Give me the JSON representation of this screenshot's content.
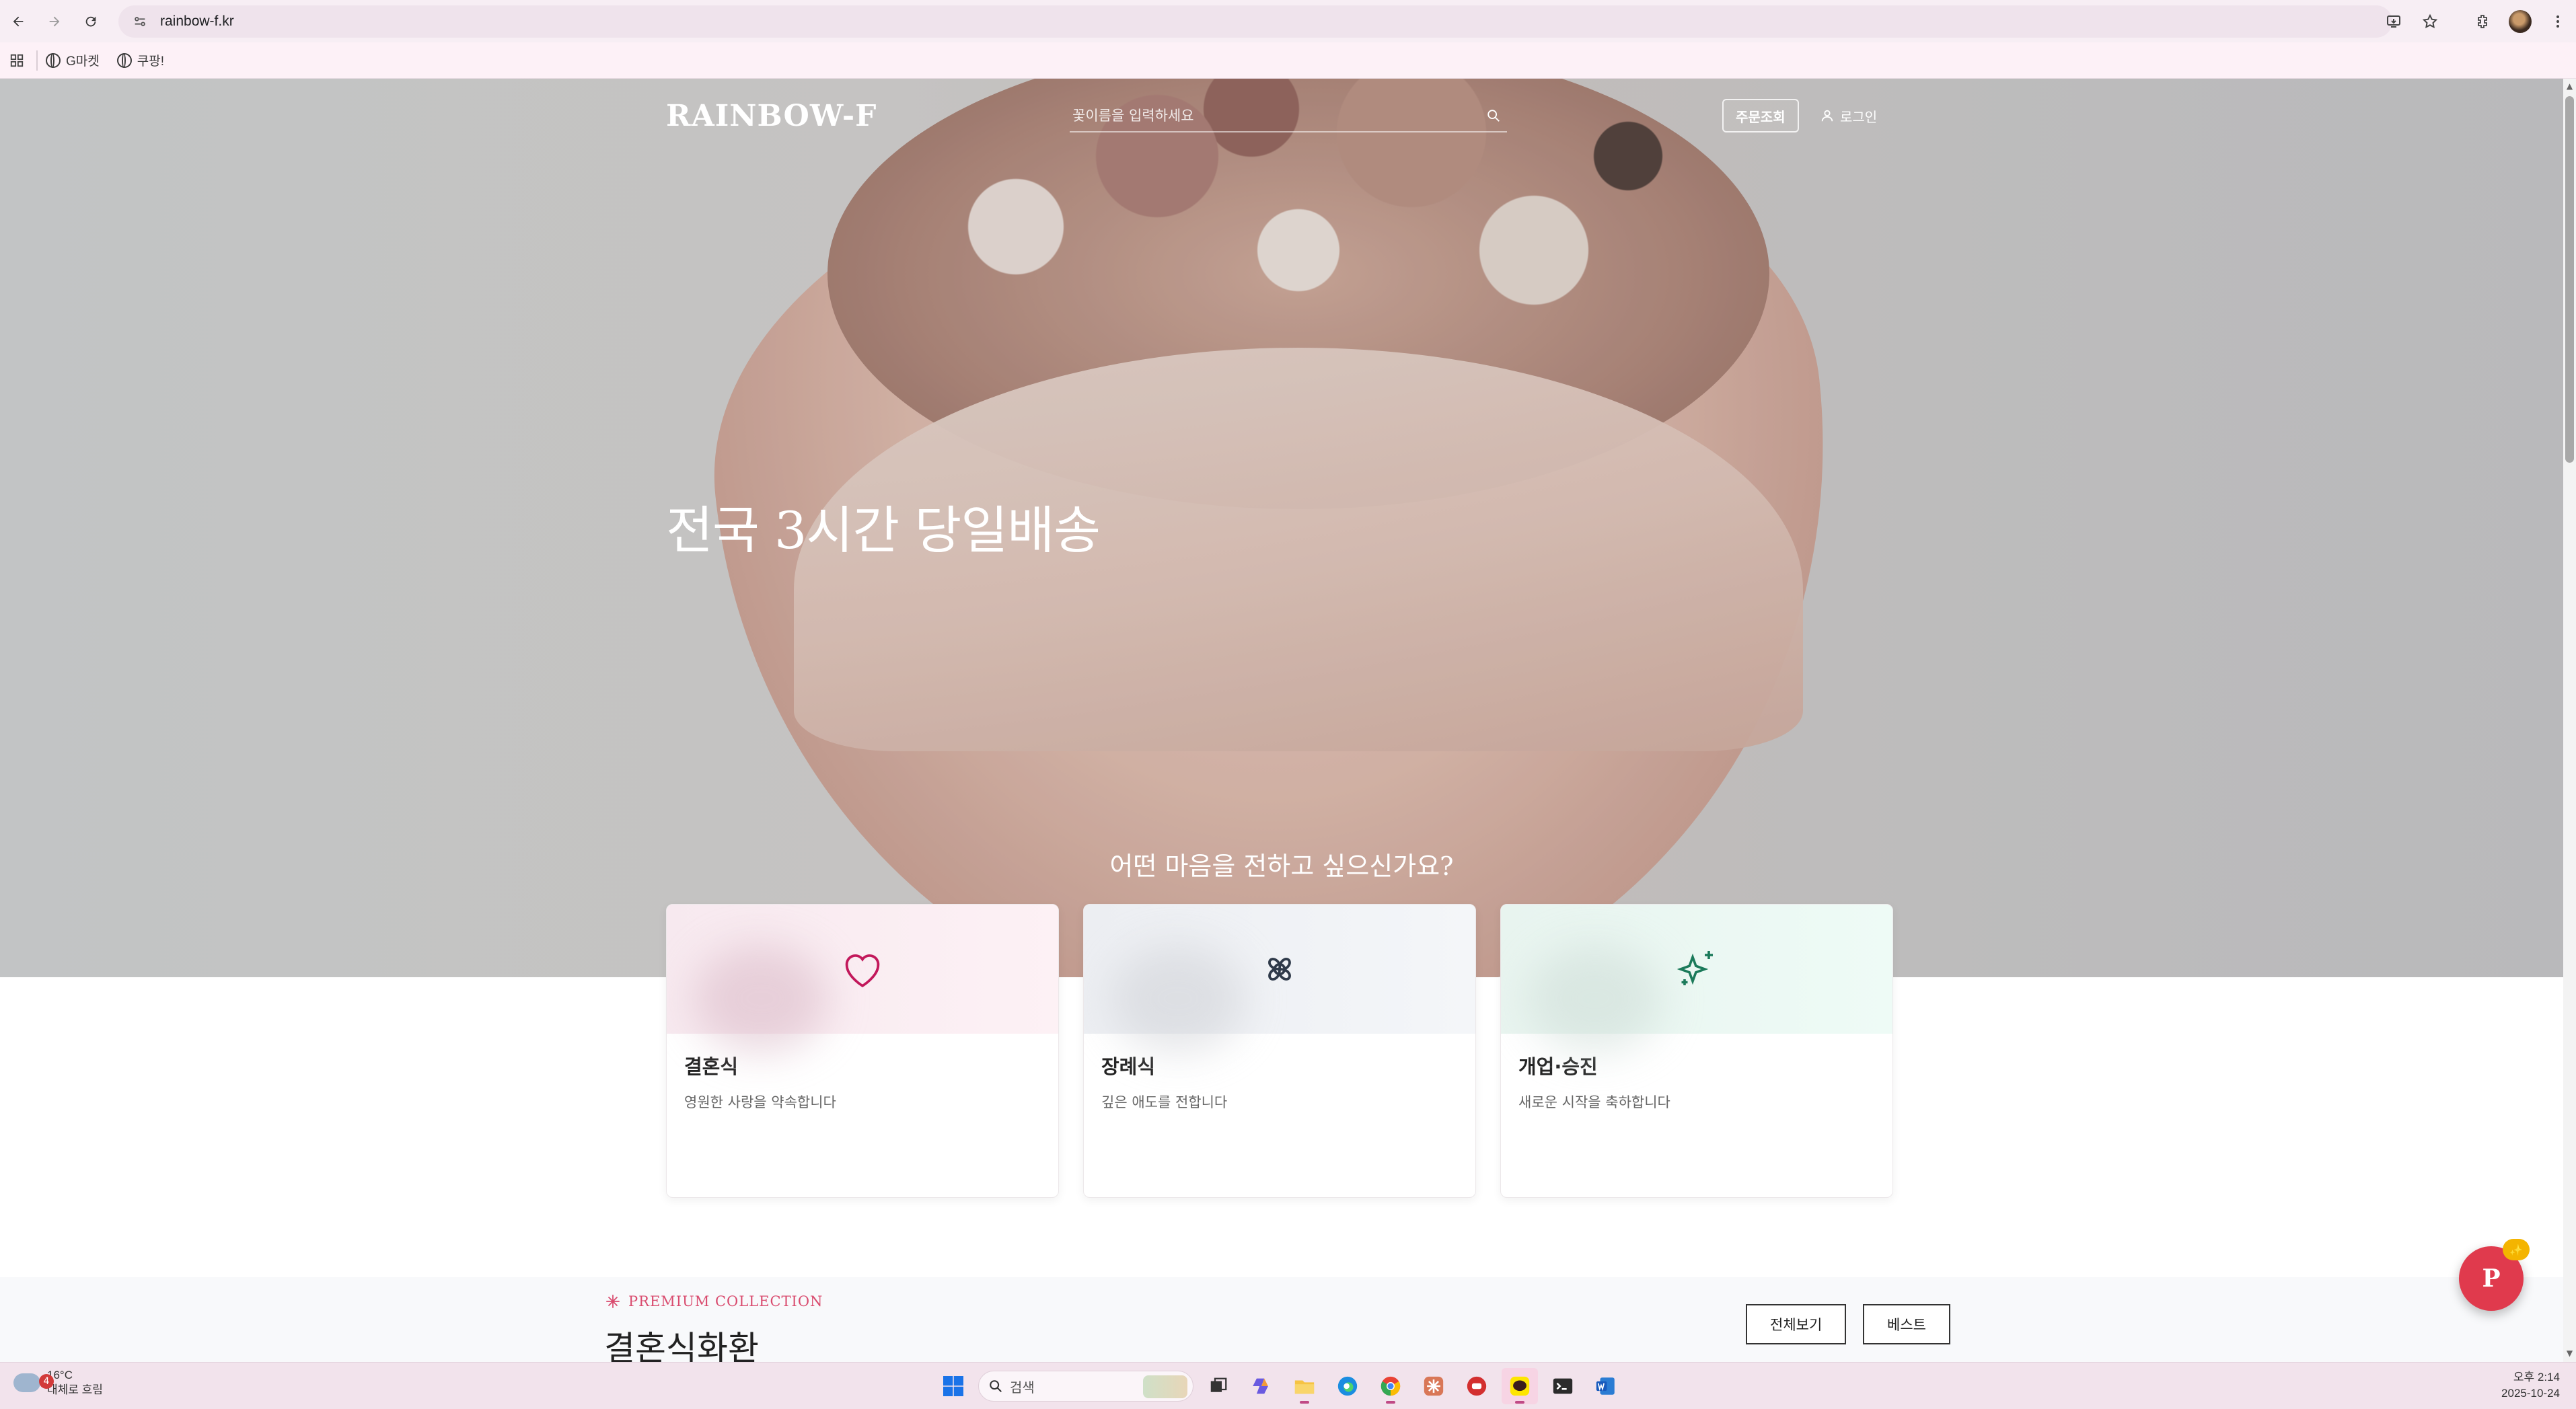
{
  "browser": {
    "url": "rainbow-f.kr",
    "bookmarks": [
      {
        "label": "G마켓"
      },
      {
        "label": "쿠팡!"
      }
    ]
  },
  "site": {
    "logo": "RAINBOW-F",
    "search_placeholder": "꽃이름을 입력하세요",
    "order_button": "주문조회",
    "login_link": "로그인",
    "hero_title": "전국 3시간 당일배송",
    "hero_question": "어떤 마음을 전하고 싶으신가요?",
    "categories": [
      {
        "title": "결혼식",
        "desc": "영원한 사랑을 약속합니다",
        "icon": "heart-icon",
        "color": "#c2185b"
      },
      {
        "title": "장례식",
        "desc": "깊은 애도를 전합니다",
        "icon": "flower-icon",
        "color": "#2f3a4a"
      },
      {
        "title": "개업·승진",
        "desc": "새로운 시작을 축하합니다",
        "icon": "sparkles-icon",
        "color": "#1b7a5a"
      }
    ],
    "collection": {
      "label": "PREMIUM COLLECTION",
      "title": "결혼식화환",
      "view_all": "전체보기",
      "best": "베스트"
    },
    "fab_letter": "P",
    "fab_badge": "✨"
  },
  "taskbar": {
    "weather_temp": "16°C",
    "weather_desc": "대체로 흐림",
    "weather_badge": "4",
    "search_placeholder": "검색",
    "time": "오후 2:14",
    "date": "2025-10-24"
  },
  "colors": {
    "accent": "#e03a4d",
    "collection_label": "#d94b6e"
  }
}
